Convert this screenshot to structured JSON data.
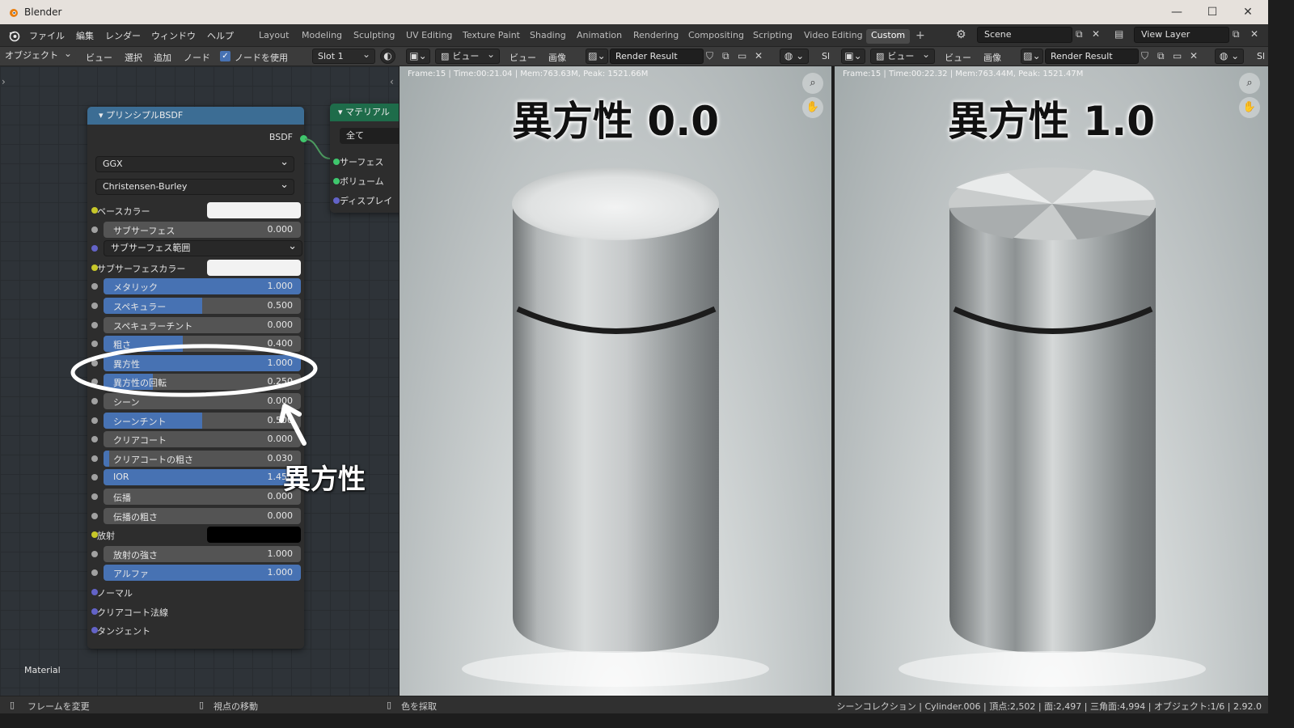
{
  "app": {
    "title": "Blender",
    "window_controls": {
      "minimize": "—",
      "maximize": "☐",
      "close": "✕"
    }
  },
  "menu": [
    "ファイル",
    "編集",
    "レンダー",
    "ウィンドウ",
    "ヘルプ"
  ],
  "workspaces": [
    "Layout",
    "Modeling",
    "Sculpting",
    "UV Editing",
    "Texture Paint",
    "Shading",
    "Animation",
    "Rendering",
    "Compositing",
    "Scripting",
    "Video Editing",
    "Custom"
  ],
  "active_workspace": "Custom",
  "add_workspace": "+",
  "scene": {
    "value": "Scene"
  },
  "view_layer": {
    "value": "View Layer"
  },
  "node_header": {
    "mode": "オブジェクト",
    "items": [
      "ビュー",
      "選択",
      "追加",
      "ノード"
    ],
    "use_nodes_label": "ノードを使用",
    "slot": "Slot 1"
  },
  "image_header": {
    "view_dropdown": "ビュー",
    "items": [
      "ビュー",
      "画像"
    ],
    "render_result": "Render Result"
  },
  "bsdf_node": {
    "title": "プリンシプルBSDF",
    "output": "BSDF",
    "distribution": "GGX",
    "subsurface_method": "Christensen-Burley",
    "rows": [
      {
        "label": "ベースカラー",
        "kind": "color",
        "socket": "yellow",
        "color": "#f2f2f2"
      },
      {
        "label": "サブサーフェス",
        "kind": "slider",
        "value": "0.000",
        "fill": 0.0
      },
      {
        "label": "サブサーフェス範囲",
        "kind": "dropdown"
      },
      {
        "label": "サブサーフェスカラー",
        "kind": "color",
        "socket": "yellow",
        "color": "#f2f2f2"
      },
      {
        "label": "メタリック",
        "kind": "slider",
        "value": "1.000",
        "fill": 1.0
      },
      {
        "label": "スペキュラー",
        "kind": "slider",
        "value": "0.500",
        "fill": 0.5
      },
      {
        "label": "スペキュラーチント",
        "kind": "slider",
        "value": "0.000",
        "fill": 0.0
      },
      {
        "label": "粗さ",
        "kind": "slider",
        "value": "0.400",
        "fill": 0.4
      },
      {
        "label": "異方性",
        "kind": "slider",
        "value": "1.000",
        "fill": 1.0
      },
      {
        "label": "異方性の回転",
        "kind": "slider",
        "value": "0.250",
        "fill": 0.25
      },
      {
        "label": "シーン",
        "kind": "slider",
        "value": "0.000",
        "fill": 0.0
      },
      {
        "label": "シーンチント",
        "kind": "slider",
        "value": "0.500",
        "fill": 0.5
      },
      {
        "label": "クリアコート",
        "kind": "slider",
        "value": "0.000",
        "fill": 0.0
      },
      {
        "label": "クリアコートの粗さ",
        "kind": "slider",
        "value": "0.030",
        "fill": 0.03
      },
      {
        "label": "IOR",
        "kind": "slider",
        "value": "1.450",
        "fill": 1.0
      },
      {
        "label": "伝播",
        "kind": "slider",
        "value": "0.000",
        "fill": 0.0
      },
      {
        "label": "伝播の粗さ",
        "kind": "slider",
        "value": "0.000",
        "fill": 0.0
      },
      {
        "label": "放射",
        "kind": "color",
        "socket": "yellow",
        "color": "#000000"
      },
      {
        "label": "放射の強さ",
        "kind": "slider",
        "value": "1.000",
        "fill": 0.0
      },
      {
        "label": "アルファ",
        "kind": "slider",
        "value": "1.000",
        "fill": 1.0
      },
      {
        "label": "ノーマル",
        "kind": "vector",
        "socket": "purple"
      },
      {
        "label": "クリアコート法線",
        "kind": "vector",
        "socket": "purple"
      },
      {
        "label": "タンジェント",
        "kind": "vector",
        "socket": "purple"
      }
    ]
  },
  "material_output": {
    "title": "マテリアル",
    "target": "全て",
    "inputs": [
      "サーフェス",
      "ボリューム",
      "ディスプレイ"
    ]
  },
  "node_tree_label": "Material",
  "annotation": "異方性",
  "viewer_left": {
    "info": "Frame:15 | Time:00:21.04 | Mem:763.63M, Peak: 1521.66M",
    "title": "異方性 0.0"
  },
  "viewer_right": {
    "info": "Frame:15 | Time:00:22.32 | Mem:763.44M, Peak: 1521.47M",
    "title": "異方性 1.0"
  },
  "statusbar": {
    "left": "フレームを変更",
    "middle": "視点の移動",
    "right": "色を採取",
    "stats": "シーンコレクション | Cylinder.006 | 頂点:2,502 | 面:2,497 | 三角面:4,994 | オブジェクト:1/6 | 2.92.0"
  }
}
